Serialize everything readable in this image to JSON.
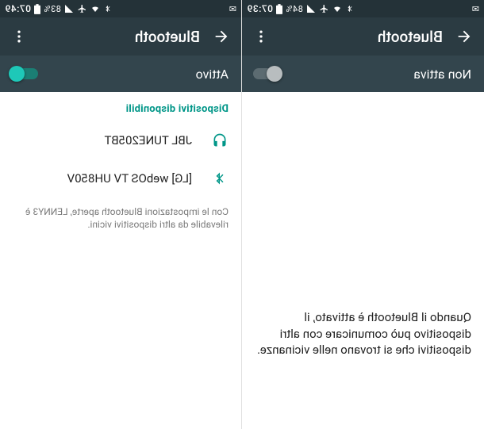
{
  "left": {
    "status": {
      "time": "07:39",
      "battery": "84%"
    },
    "appbar": {
      "title": "Bluetooth"
    },
    "toggle": {
      "label": "Non attiva",
      "on": false
    },
    "hint": "Quando il Bluetooth è attivato, il dispositivo può comunicare con altri dispositivi che si trovano nelle vicinanze."
  },
  "right": {
    "status": {
      "time": "07:49",
      "battery": "83%"
    },
    "appbar": {
      "title": "Bluetooth"
    },
    "toggle": {
      "label": "Attivo",
      "on": true
    },
    "section": "Dispositivi disponibili",
    "devices": [
      {
        "icon": "headphones",
        "name": "JBL TUNE205BT"
      },
      {
        "icon": "bluetooth",
        "name": "[LG] webOS TV UH850V"
      }
    ],
    "note": "Con le impostazioni Bluetooth aperte, LENNY3 è rilevabile da altri dispositivi vicini."
  }
}
